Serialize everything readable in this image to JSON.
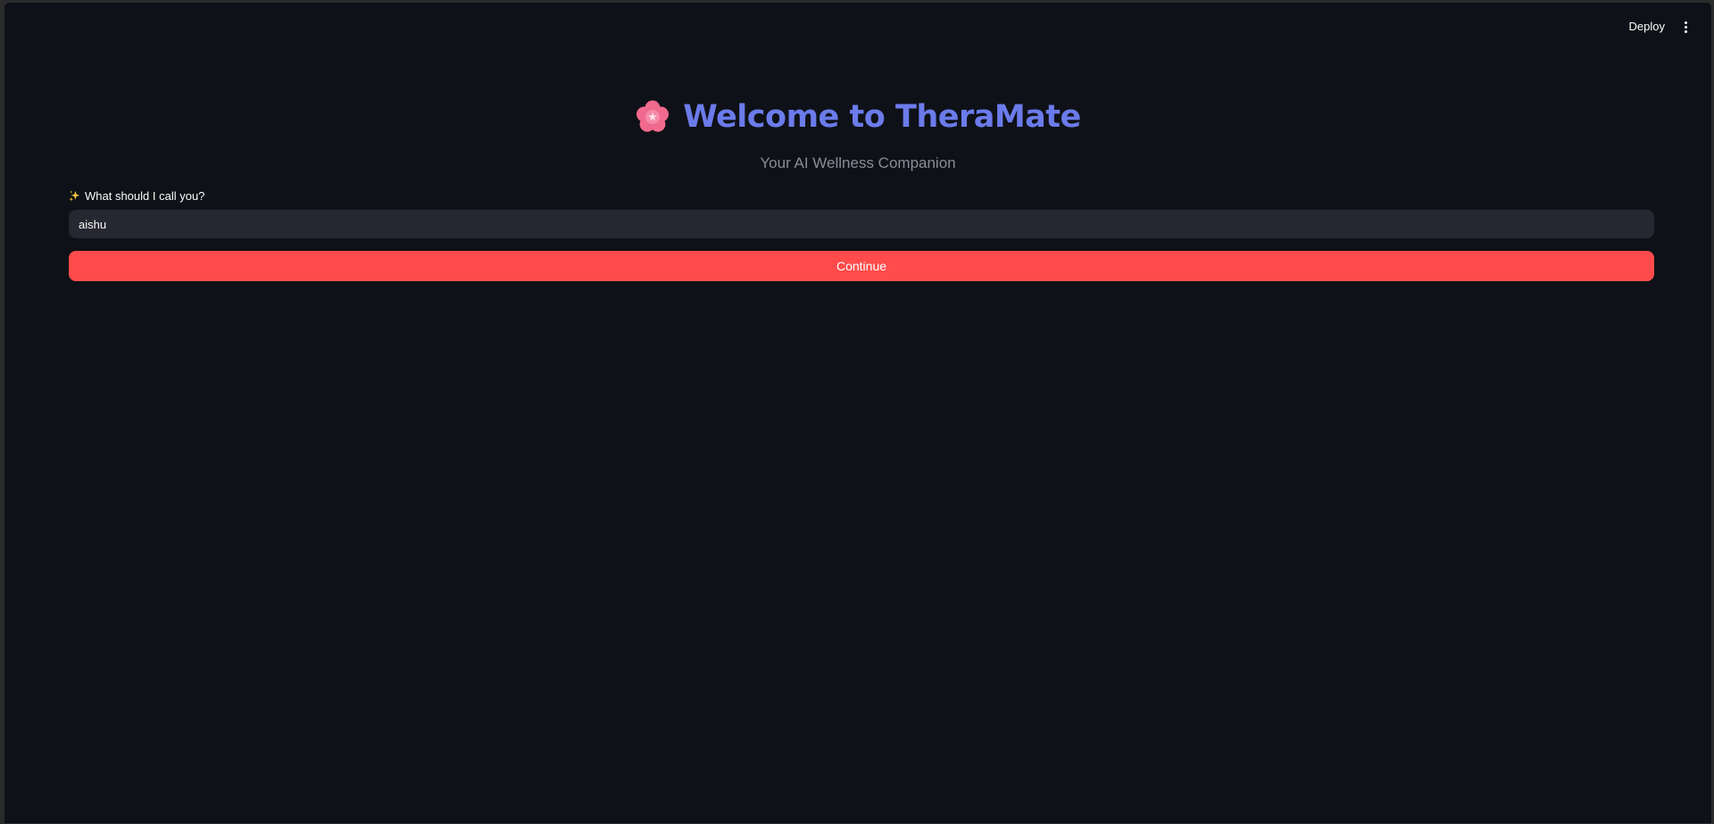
{
  "header": {
    "deploy_label": "Deploy",
    "menu_icon": "more-vertical-icon"
  },
  "welcome": {
    "title": "Welcome to TheraMate",
    "title_icon": "cherry-blossom-icon",
    "subtitle": "Your AI Wellness Companion"
  },
  "name_form": {
    "label_icon": "sparkles-icon",
    "label": "What should I call you?",
    "value": "aishu",
    "continue_label": "Continue"
  },
  "colors": {
    "background": "#0e1117",
    "title": "#6b7bea",
    "subtitle": "#8a8d96",
    "input_background": "#262730",
    "primary_button": "#ff4b4b",
    "text": "#fafafa"
  }
}
